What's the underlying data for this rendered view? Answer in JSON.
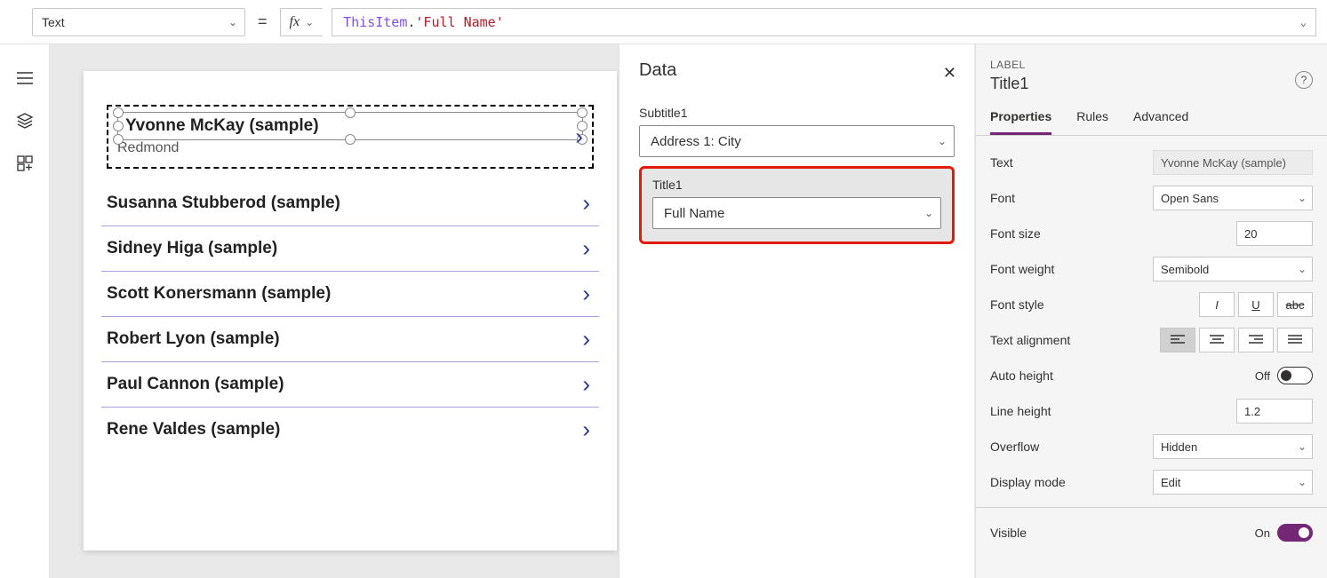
{
  "formula_bar": {
    "property": "Text",
    "equals": "=",
    "tokens": {
      "object": "ThisItem",
      "dot": ".",
      "property": "'Full Name'"
    }
  },
  "gallery": {
    "selected_subtitle": "Redmond",
    "items": [
      {
        "title": "Yvonne McKay (sample)"
      },
      {
        "title": "Susanna Stubberod (sample)"
      },
      {
        "title": "Sidney Higa (sample)"
      },
      {
        "title": "Scott Konersmann (sample)"
      },
      {
        "title": "Robert Lyon (sample)"
      },
      {
        "title": "Paul Cannon (sample)"
      },
      {
        "title": "Rene Valdes (sample)"
      }
    ]
  },
  "data_panel": {
    "title": "Data",
    "fields": {
      "subtitle_label": "Subtitle1",
      "subtitle_value": "Address 1: City",
      "title_label": "Title1",
      "title_value": "Full Name"
    }
  },
  "prop_pane": {
    "kind": "LABEL",
    "name": "Title1",
    "tabs": {
      "properties": "Properties",
      "rules": "Rules",
      "advanced": "Advanced"
    },
    "rows": {
      "text_label": "Text",
      "text_value": "Yvonne McKay (sample)",
      "font_label": "Font",
      "font_value": "Open Sans",
      "fontsize_label": "Font size",
      "fontsize_value": "20",
      "fontweight_label": "Font weight",
      "fontweight_value": "Semibold",
      "fontstyle_label": "Font style",
      "align_label": "Text alignment",
      "autoheight_label": "Auto height",
      "autoheight_state": "Off",
      "lineheight_label": "Line height",
      "lineheight_value": "1.2",
      "overflow_label": "Overflow",
      "overflow_value": "Hidden",
      "display_label": "Display mode",
      "display_value": "Edit",
      "visible_label": "Visible",
      "visible_state": "On"
    }
  }
}
